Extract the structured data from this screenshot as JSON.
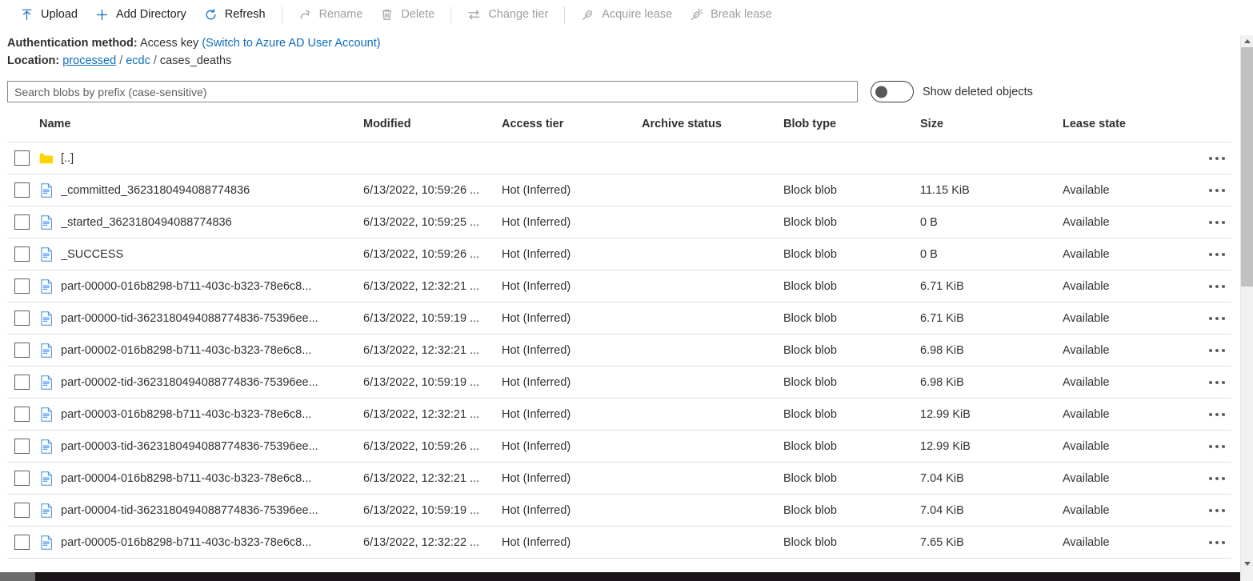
{
  "toolbar": {
    "items": [
      {
        "label": "Upload",
        "icon": "upload-icon",
        "disabled": false,
        "sep_after": false
      },
      {
        "label": "Add Directory",
        "icon": "plus-icon",
        "disabled": false,
        "sep_after": false
      },
      {
        "label": "Refresh",
        "icon": "refresh-icon",
        "disabled": false,
        "sep_after": true
      },
      {
        "label": "Rename",
        "icon": "rename-icon",
        "disabled": true,
        "sep_after": false
      },
      {
        "label": "Delete",
        "icon": "trash-icon",
        "disabled": true,
        "sep_after": true
      },
      {
        "label": "Change tier",
        "icon": "change-tier-icon",
        "disabled": true,
        "sep_after": true
      },
      {
        "label": "Acquire lease",
        "icon": "acquire-lease-icon",
        "disabled": true,
        "sep_after": false
      },
      {
        "label": "Break lease",
        "icon": "break-lease-icon",
        "disabled": true,
        "sep_after": false
      }
    ]
  },
  "info": {
    "auth_label": "Authentication method:",
    "auth_value": "Access key",
    "auth_switch_link": "(Switch to Azure AD User Account)",
    "location_label": "Location:",
    "breadcrumb": [
      {
        "text": "processed",
        "link": true,
        "underline": true
      },
      {
        "text": "ecdc",
        "link": true,
        "underline": false
      },
      {
        "text": "cases_deaths",
        "link": false,
        "underline": false
      }
    ],
    "breadcrumb_separator": "/"
  },
  "search": {
    "placeholder": "Search blobs by prefix (case-sensitive)",
    "value": ""
  },
  "deleted_toggle": {
    "label": "Show deleted objects",
    "checked": false
  },
  "table": {
    "columns": [
      "Name",
      "Modified",
      "Access tier",
      "Archive status",
      "Blob type",
      "Size",
      "Lease state"
    ],
    "rows": [
      {
        "icon": "folder-icon",
        "name": "[..]",
        "modified": "",
        "access_tier": "",
        "archive_status": "",
        "blob_type": "",
        "size": "",
        "lease_state": ""
      },
      {
        "icon": "file-icon",
        "name": "_committed_3623180494088774836",
        "modified": "6/13/2022, 10:59:26 ...",
        "access_tier": "Hot (Inferred)",
        "archive_status": "",
        "blob_type": "Block blob",
        "size": "11.15 KiB",
        "lease_state": "Available"
      },
      {
        "icon": "file-icon",
        "name": "_started_3623180494088774836",
        "modified": "6/13/2022, 10:59:25 ...",
        "access_tier": "Hot (Inferred)",
        "archive_status": "",
        "blob_type": "Block blob",
        "size": "0 B",
        "lease_state": "Available"
      },
      {
        "icon": "file-icon",
        "name": "_SUCCESS",
        "modified": "6/13/2022, 10:59:26 ...",
        "access_tier": "Hot (Inferred)",
        "archive_status": "",
        "blob_type": "Block blob",
        "size": "0 B",
        "lease_state": "Available"
      },
      {
        "icon": "file-icon",
        "name": "part-00000-016b8298-b711-403c-b323-78e6c8...",
        "modified": "6/13/2022, 12:32:21 ...",
        "access_tier": "Hot (Inferred)",
        "archive_status": "",
        "blob_type": "Block blob",
        "size": "6.71 KiB",
        "lease_state": "Available"
      },
      {
        "icon": "file-icon",
        "name": "part-00000-tid-3623180494088774836-75396ee...",
        "modified": "6/13/2022, 10:59:19 ...",
        "access_tier": "Hot (Inferred)",
        "archive_status": "",
        "blob_type": "Block blob",
        "size": "6.71 KiB",
        "lease_state": "Available"
      },
      {
        "icon": "file-icon",
        "name": "part-00002-016b8298-b711-403c-b323-78e6c8...",
        "modified": "6/13/2022, 12:32:21 ...",
        "access_tier": "Hot (Inferred)",
        "archive_status": "",
        "blob_type": "Block blob",
        "size": "6.98 KiB",
        "lease_state": "Available"
      },
      {
        "icon": "file-icon",
        "name": "part-00002-tid-3623180494088774836-75396ee...",
        "modified": "6/13/2022, 10:59:19 ...",
        "access_tier": "Hot (Inferred)",
        "archive_status": "",
        "blob_type": "Block blob",
        "size": "6.98 KiB",
        "lease_state": "Available"
      },
      {
        "icon": "file-icon",
        "name": "part-00003-016b8298-b711-403c-b323-78e6c8...",
        "modified": "6/13/2022, 12:32:21 ...",
        "access_tier": "Hot (Inferred)",
        "archive_status": "",
        "blob_type": "Block blob",
        "size": "12.99 KiB",
        "lease_state": "Available"
      },
      {
        "icon": "file-icon",
        "name": "part-00003-tid-3623180494088774836-75396ee...",
        "modified": "6/13/2022, 10:59:26 ...",
        "access_tier": "Hot (Inferred)",
        "archive_status": "",
        "blob_type": "Block blob",
        "size": "12.99 KiB",
        "lease_state": "Available"
      },
      {
        "icon": "file-icon",
        "name": "part-00004-016b8298-b711-403c-b323-78e6c8...",
        "modified": "6/13/2022, 12:32:21 ...",
        "access_tier": "Hot (Inferred)",
        "archive_status": "",
        "blob_type": "Block blob",
        "size": "7.04 KiB",
        "lease_state": "Available"
      },
      {
        "icon": "file-icon",
        "name": "part-00004-tid-3623180494088774836-75396ee...",
        "modified": "6/13/2022, 10:59:19 ...",
        "access_tier": "Hot (Inferred)",
        "archive_status": "",
        "blob_type": "Block blob",
        "size": "7.04 KiB",
        "lease_state": "Available"
      },
      {
        "icon": "file-icon",
        "name": "part-00005-016b8298-b711-403c-b323-78e6c8...",
        "modified": "6/13/2022, 12:32:22 ...",
        "access_tier": "Hot (Inferred)",
        "archive_status": "",
        "blob_type": "Block blob",
        "size": "7.65 KiB",
        "lease_state": "Available"
      }
    ],
    "row_menu_icon": "more-actions-icon"
  },
  "colors": {
    "link": "#0f6cbd",
    "folder": "#ffd400",
    "file_outline": "#3b8ede",
    "text": "#323130",
    "disabled_text": "#a19f9d",
    "border": "#e1dfdd"
  }
}
